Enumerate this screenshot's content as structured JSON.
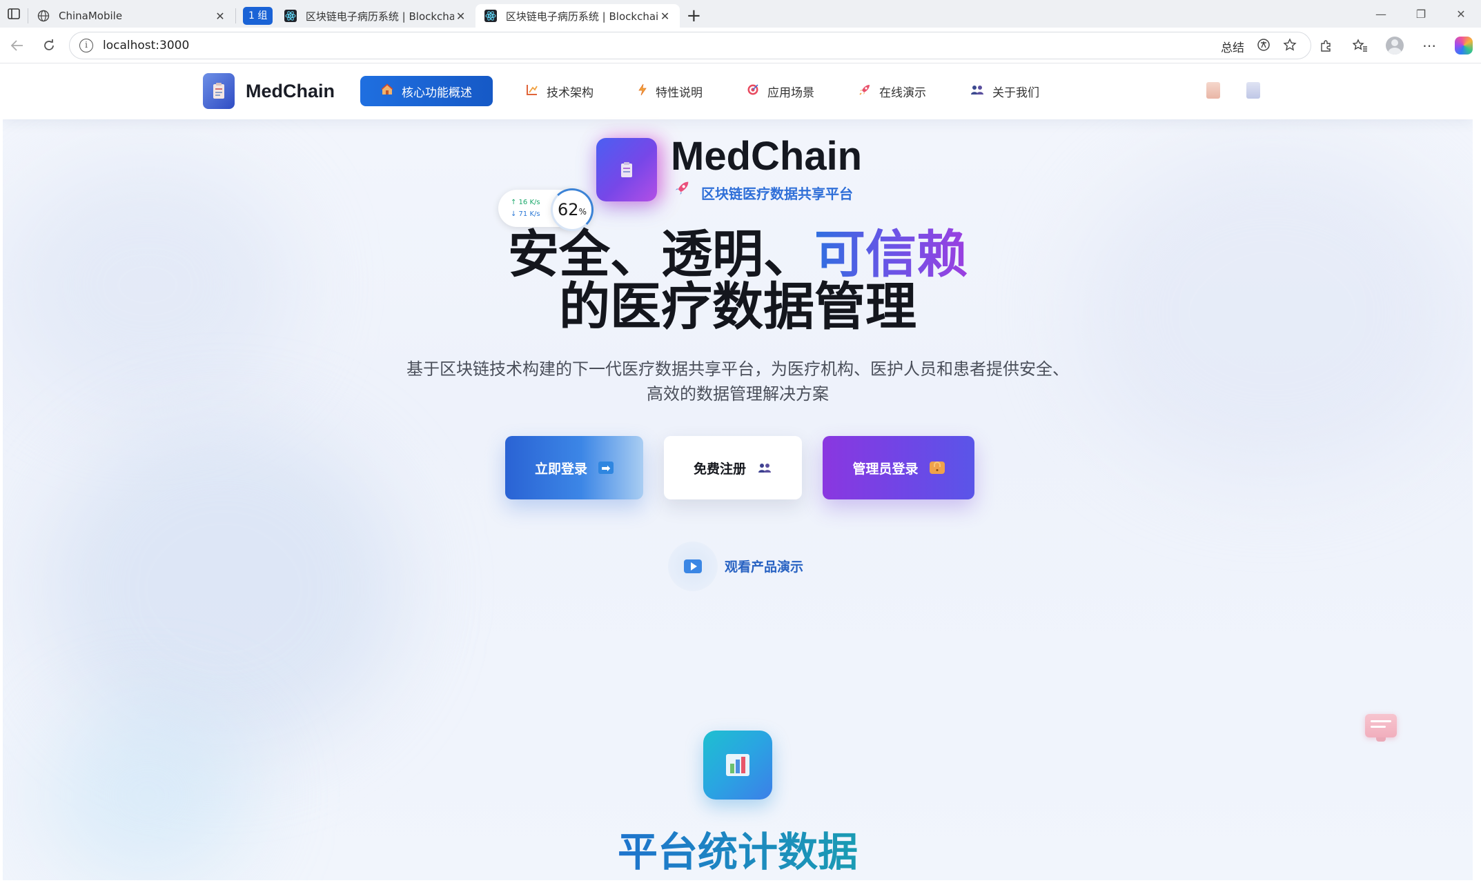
{
  "browser": {
    "tabs": [
      {
        "title": "ChinaMobile",
        "icon": "globe-icon",
        "active": false
      },
      {
        "title": "区块链电子病历系统 | Blockchain",
        "icon": "react-icon",
        "active": false
      },
      {
        "title": "区块链电子病历系统 | Blockchain",
        "icon": "react-icon",
        "active": true
      }
    ],
    "group_label": "1 组",
    "url": "localhost:3000",
    "summary_label": "总结"
  },
  "site": {
    "brand": "MedChain",
    "nav": [
      {
        "label": "核心功能概述",
        "icon": "home-icon",
        "active": true
      },
      {
        "label": "技术架构",
        "icon": "blueprint-icon",
        "active": false
      },
      {
        "label": "特性说明",
        "icon": "lightning-icon",
        "active": false
      },
      {
        "label": "应用场景",
        "icon": "target-icon",
        "active": false
      },
      {
        "label": "在线演示",
        "icon": "rocket-icon",
        "active": false
      },
      {
        "label": "关于我们",
        "icon": "users-icon",
        "active": false
      }
    ]
  },
  "speed_widget": {
    "up": "↑ 16  K/s",
    "down": "↓ 71  K/s",
    "percent": "62",
    "percent_unit": "%"
  },
  "hero": {
    "brand": "MedChain",
    "tagline": "区块链医疗数据共享平台",
    "headline_part1": "安全、透明、",
    "headline_highlight": "可信赖",
    "headline_line2": "的医疗数据管理",
    "subtitle": "基于区块链技术构建的下一代医疗数据共享平台，为医疗机构、医护人员和患者提供安全、高效的数据管理解决方案",
    "buttons": {
      "login": "立即登录",
      "register": "免费注册",
      "admin": "管理员登录"
    },
    "demo_link": "观看产品演示"
  },
  "stats": {
    "title": "平台统计数据"
  },
  "colors": {
    "primary": "#1f6fe0",
    "accent_purple": "#8a37e0",
    "teal": "#1ec0d0"
  }
}
